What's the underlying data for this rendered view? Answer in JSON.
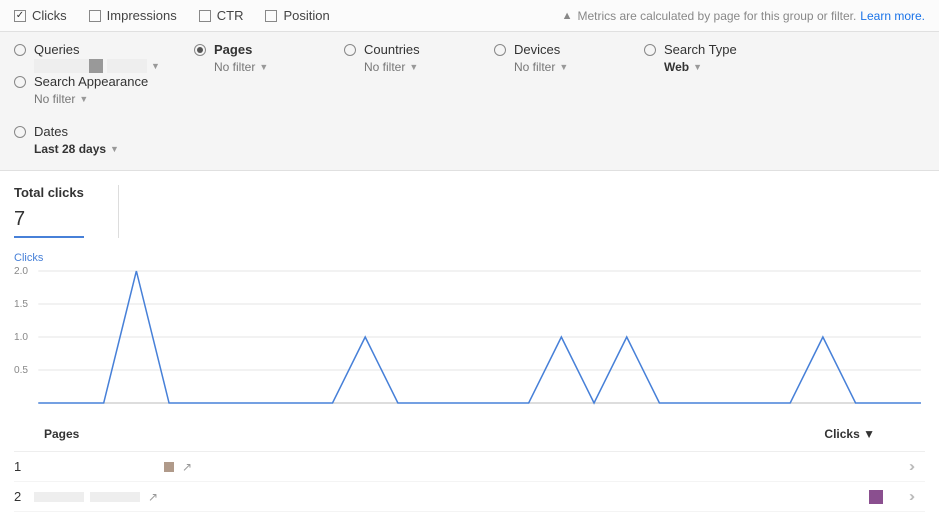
{
  "metrics": {
    "clicks": "Clicks",
    "impressions": "Impressions",
    "ctr": "CTR",
    "position": "Position"
  },
  "info_note": "Metrics are calculated by page for this group or filter.",
  "learn_more": "Learn more.",
  "filters": {
    "queries": {
      "label": "Queries"
    },
    "pages": {
      "label": "Pages",
      "value": "No filter"
    },
    "countries": {
      "label": "Countries",
      "value": "No filter"
    },
    "devices": {
      "label": "Devices",
      "value": "No filter"
    },
    "search_type": {
      "label": "Search Type",
      "value": "Web"
    },
    "search_appearance": {
      "label": "Search Appearance",
      "value": "No filter"
    },
    "dates": {
      "label": "Dates",
      "value": "Last 28 days"
    }
  },
  "tab": {
    "title": "Total clicks",
    "value": "7"
  },
  "chart_label": "Clicks",
  "chart_data": {
    "type": "line",
    "title": "Clicks",
    "xlabel": "",
    "ylabel": "Clicks",
    "ylim": [
      0,
      2.0
    ],
    "yticks": [
      0.5,
      1.0,
      1.5,
      2.0
    ],
    "x": [
      0,
      1,
      2,
      3,
      4,
      5,
      6,
      7,
      8,
      9,
      10,
      11,
      12,
      13,
      14,
      15,
      16,
      17,
      18,
      19,
      20,
      21,
      22,
      23,
      24,
      25,
      26,
      27
    ],
    "values": [
      0,
      0,
      0,
      2,
      0,
      0,
      0,
      0,
      0,
      0,
      1,
      0,
      0,
      0,
      0,
      0,
      1,
      0,
      1,
      0,
      0,
      0,
      0,
      0,
      1,
      0,
      0,
      0
    ]
  },
  "table": {
    "head_pages": "Pages",
    "head_clicks": "Clicks ▼",
    "rows": [
      {
        "idx": "1"
      },
      {
        "idx": "2"
      }
    ]
  }
}
